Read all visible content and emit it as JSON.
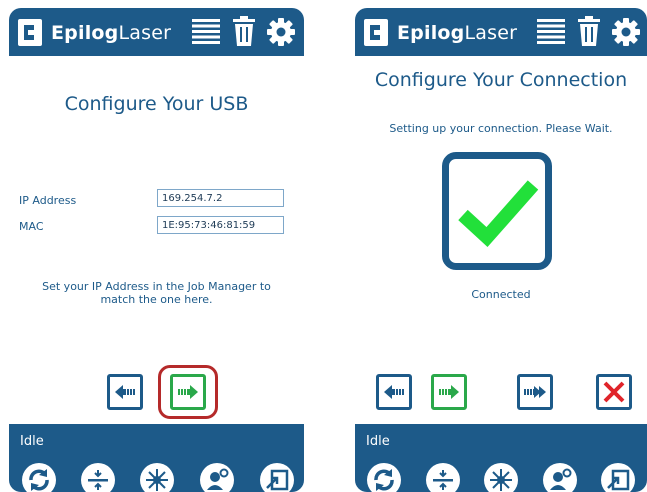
{
  "brand": {
    "bold": "Epilog",
    "light": "Laser"
  },
  "left_screen": {
    "title": "Configure Your USB",
    "fields": [
      {
        "label": "IP Address",
        "value": "169.254.7.2"
      },
      {
        "label": "MAC",
        "value": "1E:95:73:46:81:59"
      }
    ],
    "instruction": "Set your IP Address in the Job Manager to match the one here.",
    "status": "Idle"
  },
  "right_screen": {
    "title": "Configure Your Connection",
    "message": "Setting up your connection. Please Wait.",
    "connected_label": "Connected",
    "status": "Idle"
  },
  "colors": {
    "header": "#1d5a89",
    "accent_green": "#2aa84a",
    "check_green": "#22e03a",
    "cancel_red": "#e0242a",
    "highlight_red": "#b52a2a"
  },
  "icons": {
    "header": [
      "hamburger-menu-icon",
      "trash-icon",
      "gear-icon"
    ],
    "footer": [
      "refresh-icon",
      "focus-icon",
      "laser-icon",
      "user-settings-icon",
      "exit-icon"
    ],
    "nav": [
      "back-arrow-icon",
      "next-arrow-icon",
      "skip-arrow-icon",
      "cancel-x-icon"
    ]
  }
}
